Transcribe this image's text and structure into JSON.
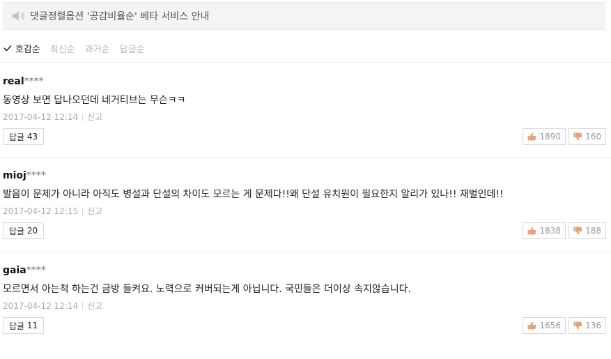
{
  "notice": {
    "text": "댓글정렬옵션 '공감비율순' 베타 서비스 안내",
    "icon": "speaker-icon"
  },
  "sort": {
    "options": [
      {
        "label": "호감순",
        "active": true
      },
      {
        "label": "최신순",
        "active": false
      },
      {
        "label": "과거순",
        "active": false
      },
      {
        "label": "답글순",
        "active": false
      }
    ]
  },
  "colors": {
    "like_icon": "#e8a07a",
    "dislike_icon": "#e8a07a",
    "muted": "#b9b9b9"
  },
  "comments": [
    {
      "author": "real",
      "mask": "****",
      "text": "동영상 보면 답나오던데 네거티브는 무슨ㅋㅋ",
      "date": "2017-04-12 12:14",
      "report": "신고",
      "reply_label": "답글",
      "replies": "43",
      "likes": "1890",
      "dislikes": "160"
    },
    {
      "author": "mioj",
      "mask": "****",
      "text": "발음이 문제가 아니라 아직도 병설과 단설의 차이도 모르는 게 문제다!!왜 단설 유치원이 필요한지 알리가 있나!! 재벌인데!!",
      "date": "2017-04-12 12:15",
      "report": "신고",
      "reply_label": "답글",
      "replies": "20",
      "likes": "1838",
      "dislikes": "188"
    },
    {
      "author": "gaia",
      "mask": "****",
      "text": "모르면서 아는척 하는건 금방 들켜요. 노력으로 커버되는게 아닙니다. 국민들은 더이상 속지않습니다.",
      "date": "2017-04-12 12:14",
      "report": "신고",
      "reply_label": "답글",
      "replies": "11",
      "likes": "1656",
      "dislikes": "136"
    }
  ]
}
